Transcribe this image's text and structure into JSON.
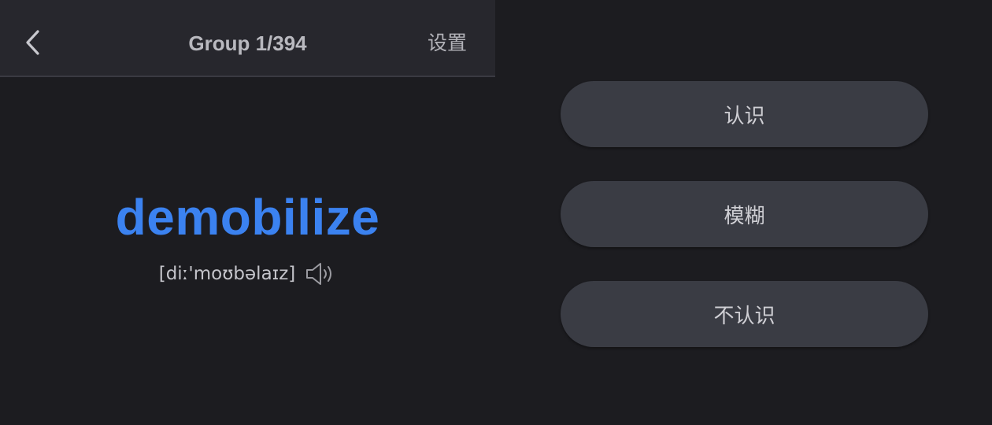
{
  "header": {
    "title": "Group 1/394",
    "settings_label": "设置"
  },
  "card": {
    "word": "demobilize",
    "phonetic": "[diː'moʊbəlaɪz]"
  },
  "choices": {
    "know": "认识",
    "fuzzy": "模糊",
    "unknown": "不认识"
  },
  "colors": {
    "accent": "#3b82f0",
    "background": "#1c1c20",
    "header_bg": "#27272d",
    "button_bg": "#3a3c44"
  },
  "icons": {
    "back": "chevron-left-icon",
    "audio": "speaker-icon"
  }
}
